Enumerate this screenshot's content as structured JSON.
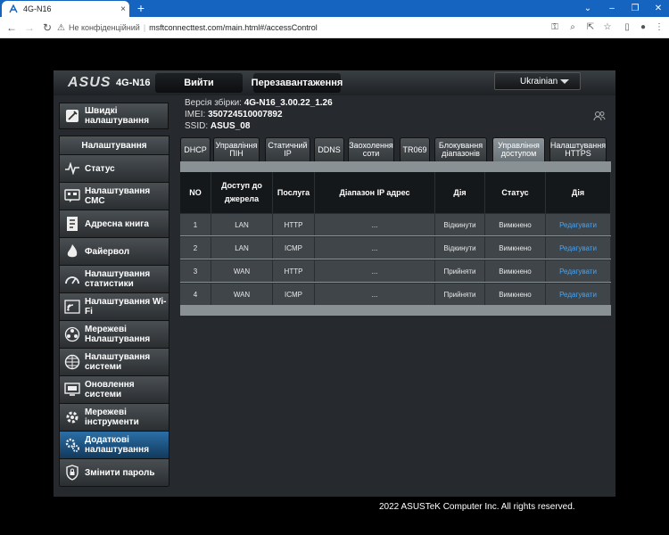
{
  "browser": {
    "tab_title": "4G-N16",
    "security_label": "Не конфіденційний",
    "url": "msftconnecttest.com/main.html#/accessControl",
    "new_tab": "+",
    "close": "×"
  },
  "header": {
    "logo": "ASUS",
    "model": "4G-N16",
    "logout": "Вийти",
    "reboot": "Перезавантаження",
    "language": "Ukrainian"
  },
  "info": {
    "firmware_label": "Версія збірки:",
    "firmware": "4G-N16_3.00.22_1.26",
    "imei_label": "IMEI:",
    "imei": "350724510007892",
    "ssid_label": "SSID:",
    "ssid": "ASUS_08"
  },
  "sidebar": {
    "quick_setup": "Швидкі налаштування",
    "section": "Налаштування",
    "items": [
      {
        "label": "Статус",
        "icon": "status-icon"
      },
      {
        "label": "Налаштування СМС",
        "icon": "sms-icon"
      },
      {
        "label": "Адресна книга",
        "icon": "address-book-icon"
      },
      {
        "label": "Файервол",
        "icon": "firewall-icon"
      },
      {
        "label": "Налаштування статистики",
        "icon": "statistics-icon"
      },
      {
        "label": "Налаштування Wi-Fi",
        "icon": "wifi-icon"
      },
      {
        "label": "Мережеві Налаштування",
        "icon": "network-icon"
      },
      {
        "label": "Налаштування системи",
        "icon": "globe-icon"
      },
      {
        "label": "Оновлення системи",
        "icon": "update-icon"
      },
      {
        "label": "Мережеві інструменти",
        "icon": "tools-icon"
      },
      {
        "label": "Додаткові налаштування",
        "icon": "advanced-icon"
      },
      {
        "label": "Змінити пароль",
        "icon": "lock-icon"
      }
    ]
  },
  "tabs": [
    {
      "label": "DHCP"
    },
    {
      "label": "Управління ПІН"
    },
    {
      "label": "Статичний IP"
    },
    {
      "label": "DDNS"
    },
    {
      "label": "Заохолення соти"
    },
    {
      "label": "TR069"
    },
    {
      "label": "Блокування діапазонів"
    },
    {
      "label": "Управління доступом"
    },
    {
      "label": "Налаштування HTTPS"
    }
  ],
  "table": {
    "headers": [
      "NO",
      "Доступ до джерела",
      "Послуга",
      "Діапазон IP адрес",
      "Дія",
      "Статус",
      "Дія"
    ],
    "rows": [
      [
        "1",
        "LAN",
        "HTTP",
        "...",
        "Відкинути",
        "Вимкнено",
        "Редагувати"
      ],
      [
        "2",
        "LAN",
        "ICMP",
        "...",
        "Відкинути",
        "Вимкнено",
        "Редагувати"
      ],
      [
        "3",
        "WAN",
        "HTTP",
        "...",
        "Прийняти",
        "Вимкнено",
        "Редагувати"
      ],
      [
        "4",
        "WAN",
        "ICMP",
        "...",
        "Прийняти",
        "Вимкнено",
        "Редагувати"
      ]
    ]
  },
  "footer": "2022 ASUSTeK Computer Inc. All rights reserved.",
  "colors": {
    "tabbar": "#1565c0",
    "active_sidebar": "#2b6fa6",
    "link": "#4aa3f0"
  }
}
